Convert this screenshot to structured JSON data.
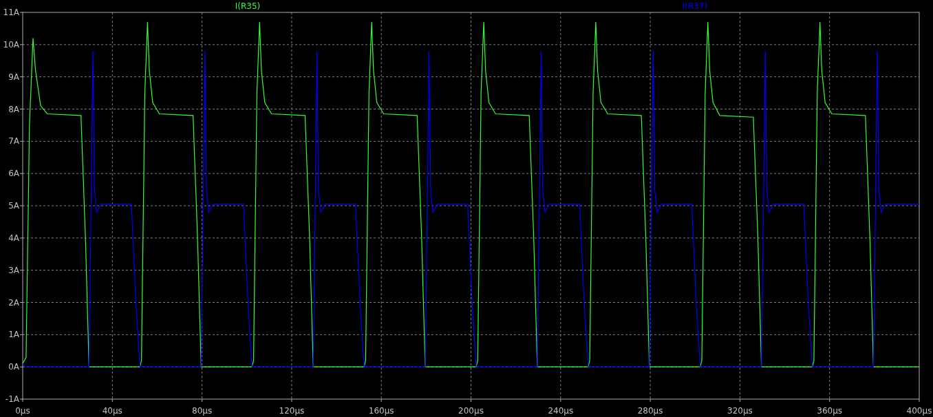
{
  "plot": {
    "chart_data": {
      "type": "line",
      "grid": true,
      "xlim": [
        0,
        400
      ],
      "ylim": [
        -1,
        11
      ],
      "xticks": [
        {
          "value": 0,
          "label": "0µs"
        },
        {
          "value": 40,
          "label": "40µs"
        },
        {
          "value": 80,
          "label": "80µs"
        },
        {
          "value": 120,
          "label": "120µs"
        },
        {
          "value": 160,
          "label": "160µs"
        },
        {
          "value": 200,
          "label": "200µs"
        },
        {
          "value": 240,
          "label": "240µs"
        },
        {
          "value": 280,
          "label": "280µs"
        },
        {
          "value": 320,
          "label": "320µs"
        },
        {
          "value": 360,
          "label": "360µs"
        },
        {
          "value": 400,
          "label": "400µs"
        }
      ],
      "yticks": [
        {
          "value": -1,
          "label": "-1A"
        },
        {
          "value": 0,
          "label": "0A"
        },
        {
          "value": 1,
          "label": "1A"
        },
        {
          "value": 2,
          "label": "2A"
        },
        {
          "value": 3,
          "label": "3A"
        },
        {
          "value": 4,
          "label": "4A"
        },
        {
          "value": 5,
          "label": "5A"
        },
        {
          "value": 6,
          "label": "6A"
        },
        {
          "value": 7,
          "label": "7A"
        },
        {
          "value": 8,
          "label": "8A"
        },
        {
          "value": 9,
          "label": "9A"
        },
        {
          "value": 10,
          "label": "10A"
        },
        {
          "value": 11,
          "label": "11A"
        }
      ],
      "x": [
        0,
        1.5,
        3,
        4.6,
        5.7,
        8,
        11,
        26,
        28,
        29.6,
        30.5,
        31.3,
        32,
        33,
        35,
        48.5,
        50.5,
        52.3,
        53,
        54.5,
        55.7,
        56.5,
        58,
        61,
        76,
        78,
        79.6,
        80.5,
        81.3,
        82,
        83,
        85,
        98.5,
        100.5,
        102.3,
        103,
        104.5,
        105.7,
        106.5,
        108,
        111,
        126,
        128,
        129.6,
        130.5,
        131.3,
        132,
        133,
        135,
        148.5,
        150.5,
        152.3,
        153,
        154.5,
        155.7,
        156.5,
        158,
        161,
        176,
        178,
        179.6,
        180.5,
        181.3,
        182,
        183,
        185,
        198.5,
        200.5,
        202.3,
        203,
        204.5,
        205.7,
        206.5,
        208,
        211,
        226,
        228,
        229.6,
        230.5,
        231.3,
        232,
        233,
        235,
        248.5,
        250.5,
        252.3,
        253,
        254.5,
        255.7,
        256.5,
        258,
        261,
        276,
        278,
        279.6,
        280.5,
        281.3,
        282,
        283,
        285,
        298.5,
        300.5,
        302.3,
        303,
        304.5,
        305.7,
        306.5,
        308,
        311,
        326,
        328,
        329.6,
        330.5,
        331.3,
        332,
        333,
        335,
        348.5,
        350.5,
        352.3,
        353,
        354.5,
        355.7,
        356.5,
        358,
        361,
        376,
        378,
        379.6,
        380.5,
        381.3,
        382,
        383,
        385,
        398.5,
        400
      ],
      "series": [
        {
          "name": "I(R35)",
          "color": "#33ff33",
          "values": [
            0.1,
            0.3,
            7.5,
            10.2,
            9.2,
            8.1,
            7.85,
            7.8,
            4,
            0,
            0,
            0,
            0,
            0,
            0,
            0,
            0,
            0,
            0.2,
            8.5,
            10.7,
            9.2,
            8.2,
            7.85,
            7.8,
            4,
            0,
            0,
            0,
            0,
            0,
            0,
            0,
            0,
            0,
            0.2,
            8.5,
            10.7,
            9.2,
            8.2,
            7.85,
            7.8,
            4,
            0,
            0,
            0,
            0,
            0,
            0,
            0,
            0,
            0,
            0.2,
            8.5,
            10.7,
            9.2,
            8.2,
            7.85,
            7.8,
            4,
            0,
            0,
            0,
            0,
            0,
            0,
            0,
            0,
            0,
            0.2,
            8.5,
            10.7,
            9.2,
            8.2,
            7.85,
            7.8,
            4,
            0,
            0,
            0,
            0,
            0,
            0,
            0,
            0,
            0,
            0.2,
            8.5,
            10.7,
            9.2,
            8.2,
            7.85,
            7.8,
            4,
            0,
            0,
            0,
            0,
            0,
            0,
            0,
            0,
            0,
            0.2,
            8.5,
            10.7,
            9.2,
            8.2,
            7.8,
            7.75,
            4,
            0,
            0,
            0,
            0,
            0,
            0,
            0,
            0,
            0,
            0.2,
            8.5,
            10.7,
            9.2,
            8.2,
            7.85,
            7.8,
            4,
            0,
            0,
            0,
            0,
            0,
            0,
            0,
            0
          ]
        },
        {
          "name": "I(R37)",
          "color": "#0000ff",
          "values": [
            0.1,
            0,
            0,
            0,
            0,
            0,
            0,
            0,
            0,
            0,
            5,
            9.8,
            5.5,
            4.8,
            5.05,
            5.05,
            2,
            0,
            0,
            0,
            0,
            0,
            0,
            0,
            0,
            0,
            0,
            5,
            9.8,
            5.5,
            4.8,
            5.05,
            5.05,
            2,
            0,
            0,
            0,
            0,
            0,
            0,
            0,
            0,
            0,
            0,
            5,
            9.8,
            5.5,
            4.8,
            5.05,
            5.05,
            2,
            0,
            0,
            0,
            0,
            0,
            0,
            0,
            0,
            0,
            0,
            5,
            9.8,
            5.5,
            4.8,
            5.05,
            5.05,
            2,
            0,
            0,
            0,
            0,
            0,
            0,
            0,
            0,
            0,
            0,
            5,
            9.8,
            5.5,
            4.8,
            5.05,
            5.05,
            2,
            0,
            0,
            0,
            0,
            0,
            0,
            0,
            0,
            0,
            0,
            5,
            9.8,
            5.5,
            4.8,
            5.05,
            5.05,
            2,
            0,
            0,
            0,
            0,
            0,
            0,
            0,
            0,
            0,
            0,
            5,
            9.8,
            5.5,
            4.8,
            5.05,
            5.05,
            2,
            0,
            0,
            0,
            0,
            0,
            0,
            0,
            0,
            0,
            0,
            5,
            9.8,
            5.5,
            4.8,
            5.05,
            5.05,
            5.05
          ]
        }
      ]
    }
  }
}
